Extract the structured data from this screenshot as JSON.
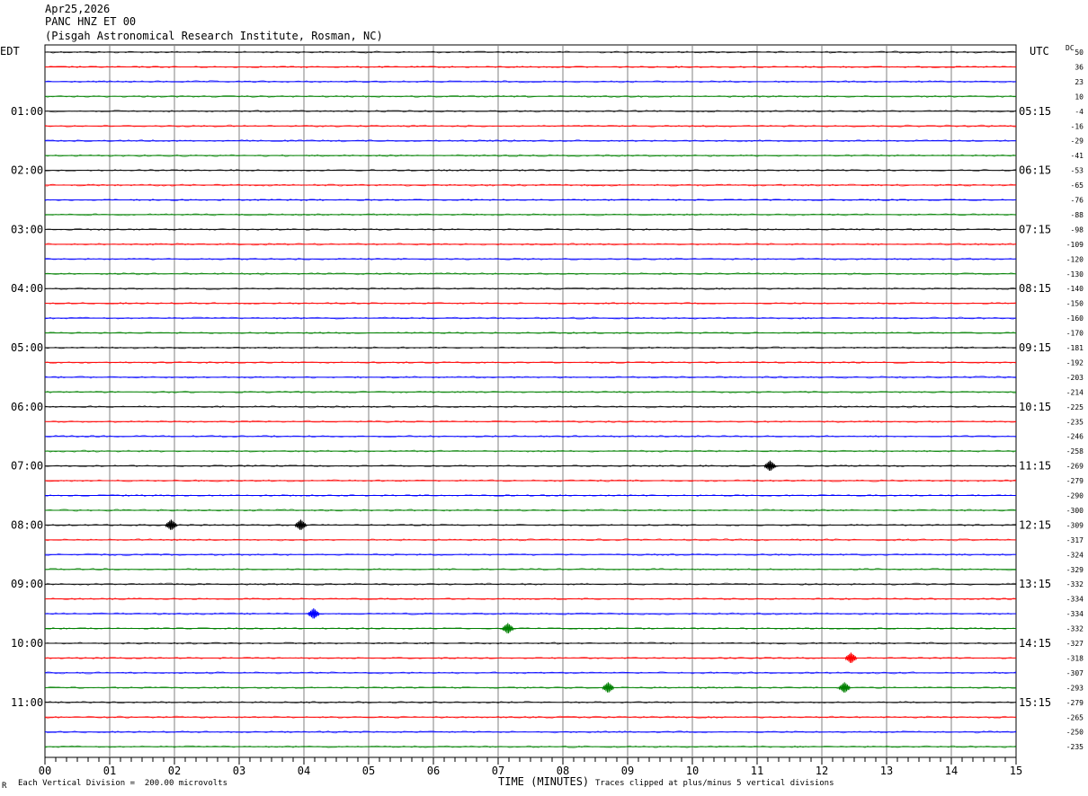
{
  "header": {
    "date": "Apr25,2026",
    "station": "PANC HNZ ET 00",
    "location": "(Pisgah Astronomical Research Institute, Rosman, NC)"
  },
  "labels": {
    "left_zone": "EDT",
    "right_zone": "UTC",
    "dc": "DC"
  },
  "footer": {
    "vertical_division": "Each Vertical Division =  200.00 microvolts",
    "x_axis_title": "TIME (MINUTES)",
    "clip_note": "Traces clipped at plus/minus 5 vertical divisions",
    "corner_mark": "R"
  },
  "colors": {
    "cycle": [
      "#000000",
      "#ff0000",
      "#0000ff",
      "#008000"
    ],
    "grid": "#808080",
    "border": "#000000"
  },
  "chart_data": {
    "type": "line",
    "title": "PANC HNZ ET 00",
    "xlabel": "TIME (MINUTES)",
    "xlim": [
      0,
      15
    ],
    "x_ticks": [
      "00",
      "01",
      "02",
      "03",
      "04",
      "05",
      "06",
      "07",
      "08",
      "09",
      "10",
      "11",
      "12",
      "13",
      "14",
      "15"
    ],
    "trace_minutes": 15,
    "trace_color_cycle": [
      "black",
      "red",
      "blue",
      "green"
    ],
    "left_hour_labels": [
      "01:00",
      "02:00",
      "03:00",
      "04:00",
      "05:00",
      "06:00",
      "07:00",
      "08:00",
      "09:00",
      "10:00",
      "11:00"
    ],
    "right_hour_labels": [
      "05:15",
      "06:15",
      "07:15",
      "08:15",
      "09:15",
      "10:15",
      "11:15",
      "12:15",
      "13:15",
      "14:15",
      "15:15"
    ],
    "dc_offsets": [
      50,
      36,
      23,
      10,
      -4,
      -16,
      -29,
      -41,
      -53,
      -65,
      -76,
      -88,
      -98,
      -109,
      -120,
      -130,
      -140,
      -150,
      -160,
      -170,
      -181,
      -192,
      -203,
      -214,
      -225,
      -235,
      -246,
      -258,
      -269,
      -279,
      -290,
      -300,
      -309,
      -317,
      -324,
      -329,
      -332,
      -334,
      -334,
      -332,
      -327,
      -318,
      -307,
      -293,
      -279,
      -265,
      -250,
      -235
    ],
    "events": [
      {
        "trace": 28,
        "minute": 11.2
      },
      {
        "trace": 32,
        "minute": 1.95
      },
      {
        "trace": 32,
        "minute": 3.95
      },
      {
        "trace": 38,
        "minute": 4.15
      },
      {
        "trace": 39,
        "minute": 7.15
      },
      {
        "trace": 41,
        "minute": 12.45
      },
      {
        "trace": 43,
        "minute": 8.7
      },
      {
        "trace": 43,
        "minute": 12.35
      }
    ],
    "vertical_division_microvolts": 200.0,
    "clip_divisions": 5
  }
}
